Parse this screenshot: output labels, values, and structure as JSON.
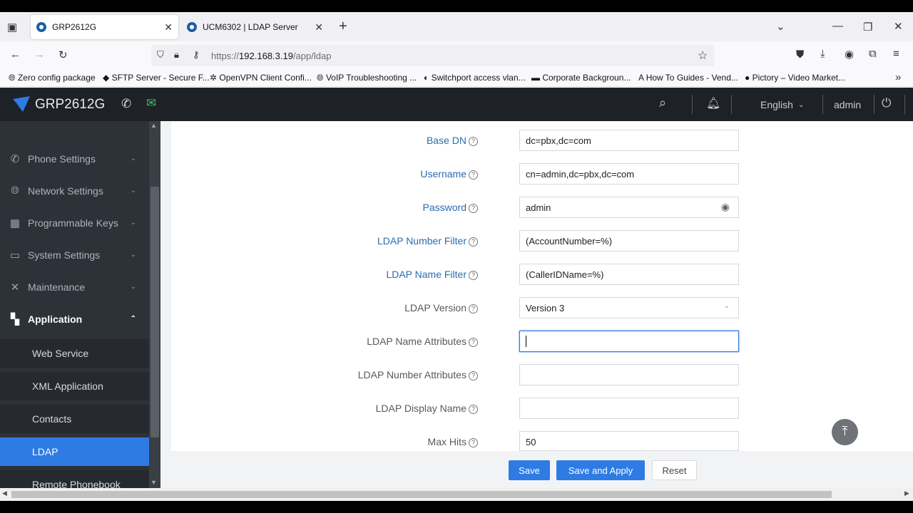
{
  "browser": {
    "tabs": [
      {
        "label": "GRP2612G",
        "active": true
      },
      {
        "label": "UCM6302 | LDAP Server",
        "active": false
      }
    ],
    "url_prefix": "https://",
    "url_host": "192.168.3.19",
    "url_path": "/app/ldap",
    "bookmarks": [
      "Zero config package",
      "SFTP Server - Secure F...",
      "OpenVPN Client Confi...",
      "VoIP Troubleshooting ...",
      "Switchport access vlan...",
      "Corporate Backgroun...",
      "How To Guides - Vend...",
      "Pictory – Video Market..."
    ]
  },
  "header": {
    "brand": "GRP2612G",
    "language": "English",
    "user": "admin"
  },
  "sidebar": {
    "items": [
      {
        "label": "Phone Settings",
        "icon": "phone-icon"
      },
      {
        "label": "Network Settings",
        "icon": "globe-icon"
      },
      {
        "label": "Programmable Keys",
        "icon": "keypad-icon"
      },
      {
        "label": "System Settings",
        "icon": "monitor-icon"
      },
      {
        "label": "Maintenance",
        "icon": "wrench-icon"
      },
      {
        "label": "Application",
        "icon": "grid-icon"
      }
    ],
    "subitems": [
      "Web Service",
      "XML Application",
      "Contacts",
      "LDAP",
      "Remote Phonebook"
    ]
  },
  "form": {
    "base_dn": {
      "label": "Base DN",
      "value": "dc=pbx,dc=com"
    },
    "username": {
      "label": "Username",
      "value": "cn=admin,dc=pbx,dc=com"
    },
    "password": {
      "label": "Password",
      "value": "admin"
    },
    "number_filter": {
      "label": "LDAP Number Filter",
      "value": "(AccountNumber=%)"
    },
    "name_filter": {
      "label": "LDAP Name Filter",
      "value": "(CallerIDName=%)"
    },
    "version": {
      "label": "LDAP Version",
      "value": "Version 3"
    },
    "name_attrs": {
      "label": "LDAP Name Attributes",
      "value": ""
    },
    "number_attrs": {
      "label": "LDAP Number Attributes",
      "value": ""
    },
    "display_name": {
      "label": "LDAP Display Name",
      "value": ""
    },
    "max_hits": {
      "label": "Max Hits",
      "value": "50"
    }
  },
  "actions": {
    "save": "Save",
    "save_apply": "Save and Apply",
    "reset": "Reset"
  },
  "help_glyph": "?",
  "colors": {
    "accent": "#2e7be4",
    "header_bg": "#1e2227",
    "sidebar_bg": "#2d3138",
    "label_blue": "#2b6cb0"
  }
}
